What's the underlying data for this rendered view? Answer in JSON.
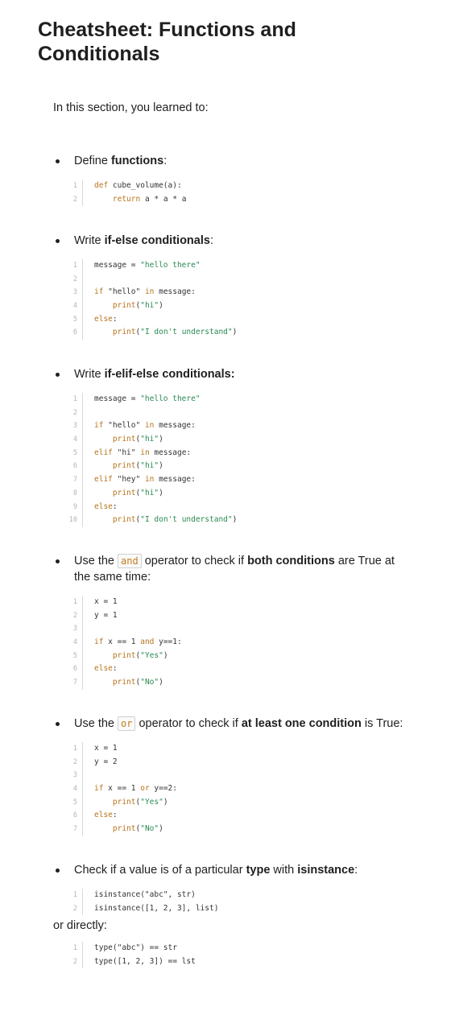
{
  "header": {
    "title": "Cheatsheet: Functions and Conditionals",
    "intro": "In this section, you learned to:"
  },
  "sections": [
    {
      "text_before": "Define ",
      "bold": "functions",
      "text_after": ":",
      "code": [
        {
          "n": "1",
          "segs": [
            [
              "kw",
              "def "
            ],
            [
              "",
              "cube_volume(a):"
            ]
          ]
        },
        {
          "n": "2",
          "segs": [
            [
              "",
              "    "
            ],
            [
              "kw",
              "return"
            ],
            [
              "",
              " a * a * a"
            ]
          ]
        }
      ]
    },
    {
      "text_before": "Write ",
      "bold": "if-else conditionals",
      "text_after": ":",
      "code": [
        {
          "n": "1",
          "segs": [
            [
              "",
              "message = "
            ],
            [
              "str",
              "\"hello there\""
            ]
          ]
        },
        {
          "n": "2",
          "segs": []
        },
        {
          "n": "3",
          "segs": [
            [
              "kw",
              "if "
            ],
            [
              "",
              "\"hello\" "
            ],
            [
              "kw",
              "in"
            ],
            [
              "",
              " message:"
            ]
          ]
        },
        {
          "n": "4",
          "segs": [
            [
              "",
              "    "
            ],
            [
              "kw",
              "print"
            ],
            [
              "",
              "("
            ],
            [
              "str",
              "\"hi\""
            ],
            [
              "",
              ")"
            ]
          ]
        },
        {
          "n": "5",
          "segs": [
            [
              "kw",
              "else"
            ],
            [
              "",
              ":"
            ]
          ]
        },
        {
          "n": "6",
          "segs": [
            [
              "",
              "    "
            ],
            [
              "kw",
              "print"
            ],
            [
              "",
              "("
            ],
            [
              "str",
              "\"I don't understand\""
            ],
            [
              "",
              ")"
            ]
          ]
        }
      ]
    },
    {
      "text_before": "Write ",
      "bold": "if-elif-else conditionals:",
      "text_after": "",
      "code": [
        {
          "n": "1",
          "segs": [
            [
              "",
              "message = "
            ],
            [
              "str",
              "\"hello there\""
            ]
          ]
        },
        {
          "n": "2",
          "segs": []
        },
        {
          "n": "3",
          "segs": [
            [
              "kw",
              "if "
            ],
            [
              "",
              "\"hello\" "
            ],
            [
              "kw",
              "in"
            ],
            [
              "",
              " message:"
            ]
          ]
        },
        {
          "n": "4",
          "segs": [
            [
              "",
              "    "
            ],
            [
              "kw",
              "print"
            ],
            [
              "",
              "("
            ],
            [
              "str",
              "\"hi\""
            ],
            [
              "",
              ")"
            ]
          ]
        },
        {
          "n": "5",
          "segs": [
            [
              "kw",
              "elif "
            ],
            [
              "",
              "\"hi\" "
            ],
            [
              "kw",
              "in"
            ],
            [
              "",
              " message:"
            ]
          ]
        },
        {
          "n": "6",
          "segs": [
            [
              "",
              "    "
            ],
            [
              "kw",
              "print"
            ],
            [
              "",
              "("
            ],
            [
              "str",
              "\"hi\""
            ],
            [
              "",
              ")"
            ]
          ]
        },
        {
          "n": "7",
          "segs": [
            [
              "kw",
              "elif "
            ],
            [
              "",
              "\"hey\" "
            ],
            [
              "kw",
              "in"
            ],
            [
              "",
              " message:"
            ]
          ]
        },
        {
          "n": "8",
          "segs": [
            [
              "",
              "    "
            ],
            [
              "kw",
              "print"
            ],
            [
              "",
              "("
            ],
            [
              "str",
              "\"hi\""
            ],
            [
              "",
              ")"
            ]
          ]
        },
        {
          "n": "9",
          "segs": [
            [
              "kw",
              "else"
            ],
            [
              "",
              ":"
            ]
          ]
        },
        {
          "n": "10",
          "segs": [
            [
              "",
              "    "
            ],
            [
              "kw",
              "print"
            ],
            [
              "",
              "("
            ],
            [
              "str",
              "\"I don't understand\""
            ],
            [
              "",
              ")"
            ]
          ]
        }
      ]
    },
    {
      "text_before": "Use the ",
      "inline_code": "and",
      "text_mid": " operator to check if ",
      "bold": "both conditions",
      "text_after": " are True at the same time:",
      "code": [
        {
          "n": "1",
          "segs": [
            [
              "",
              "x = 1"
            ]
          ]
        },
        {
          "n": "2",
          "segs": [
            [
              "",
              "y = 1"
            ]
          ]
        },
        {
          "n": "3",
          "segs": []
        },
        {
          "n": "4",
          "segs": [
            [
              "kw",
              "if "
            ],
            [
              "",
              "x == 1 "
            ],
            [
              "kw",
              "and"
            ],
            [
              "",
              " y==1:"
            ]
          ]
        },
        {
          "n": "5",
          "segs": [
            [
              "",
              "    "
            ],
            [
              "kw",
              "print"
            ],
            [
              "",
              "("
            ],
            [
              "str",
              "\"Yes\""
            ],
            [
              "",
              ")"
            ]
          ]
        },
        {
          "n": "6",
          "segs": [
            [
              "kw",
              "else"
            ],
            [
              "",
              ":"
            ]
          ]
        },
        {
          "n": "7",
          "segs": [
            [
              "",
              "    "
            ],
            [
              "kw",
              "print"
            ],
            [
              "",
              "("
            ],
            [
              "str",
              "\"No\""
            ],
            [
              "",
              ")"
            ]
          ]
        }
      ]
    },
    {
      "text_before": "Use the ",
      "inline_code": "or",
      "text_mid": " operator to check if ",
      "bold": "at least one condition",
      "text_after": " is True:",
      "code": [
        {
          "n": "1",
          "segs": [
            [
              "",
              "x = 1"
            ]
          ]
        },
        {
          "n": "2",
          "segs": [
            [
              "",
              "y = 2"
            ]
          ]
        },
        {
          "n": "3",
          "segs": []
        },
        {
          "n": "4",
          "segs": [
            [
              "kw",
              "if "
            ],
            [
              "",
              "x == 1 "
            ],
            [
              "kw",
              "or"
            ],
            [
              "",
              " y==2:"
            ]
          ]
        },
        {
          "n": "5",
          "segs": [
            [
              "",
              "    "
            ],
            [
              "kw",
              "print"
            ],
            [
              "",
              "("
            ],
            [
              "str",
              "\"Yes\""
            ],
            [
              "",
              ")"
            ]
          ]
        },
        {
          "n": "6",
          "segs": [
            [
              "kw",
              "else"
            ],
            [
              "",
              ":"
            ]
          ]
        },
        {
          "n": "7",
          "segs": [
            [
              "",
              "    "
            ],
            [
              "kw",
              "print"
            ],
            [
              "",
              "("
            ],
            [
              "str",
              "\"No\""
            ],
            [
              "",
              ")"
            ]
          ]
        }
      ]
    },
    {
      "text_before": "Check if a value is of a particular ",
      "bold": "type",
      "text_mid2": " with ",
      "bold2": "isinstance",
      "text_after": ":",
      "code": [
        {
          "n": "1",
          "segs": [
            [
              "",
              "isinstance(\"abc\", str)"
            ]
          ]
        },
        {
          "n": "2",
          "segs": [
            [
              "",
              "isinstance([1, 2, 3], list)"
            ]
          ]
        }
      ]
    }
  ],
  "or_directly": "or directly:",
  "final_code": [
    {
      "n": "1",
      "segs": [
        [
          "",
          "type(\"abc\") == str"
        ]
      ]
    },
    {
      "n": "2",
      "segs": [
        [
          "",
          "type([1, 2, 3]) == lst"
        ]
      ]
    }
  ]
}
